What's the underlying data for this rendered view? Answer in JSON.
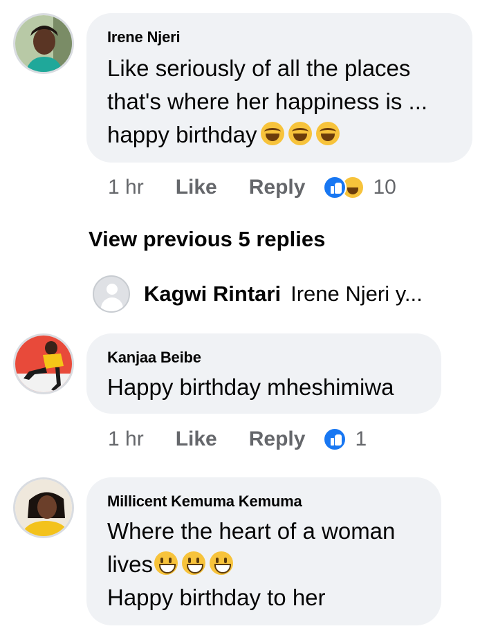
{
  "comments": [
    {
      "author": "Irene Njeri",
      "text_lines": [
        "Like seriously of all the places",
        "that's where her happiness is ...",
        "happy birthday"
      ],
      "emojis": [
        "laughing-emoji",
        "laughing-emoji",
        "laughing-emoji"
      ],
      "time": "1 hr",
      "like_label": "Like",
      "reply_label": "Reply",
      "reactions": [
        "like",
        "haha"
      ],
      "reaction_count": "10"
    },
    {
      "author": "Kanjaa Beibe",
      "text_lines": [
        "Happy birthday mheshimiwa"
      ],
      "time": "1 hr",
      "like_label": "Like",
      "reply_label": "Reply",
      "reactions": [
        "like"
      ],
      "reaction_count": "1"
    },
    {
      "author": "Millicent Kemuma Kemuma",
      "text_lines": [
        "Where the heart of a woman",
        "lives",
        "Happy birthday to her"
      ],
      "emojis": [
        "smiley-emoji",
        "smiley-emoji",
        "smiley-emoji"
      ]
    }
  ],
  "view_previous": "View previous 5 replies",
  "reply_preview": {
    "author": "Kagwi Rintari",
    "snippet": "Irene Njeri y..."
  },
  "colors": {
    "bubble": "#f0f2f5",
    "meta_text": "#65676b",
    "like_blue": "#1877f2",
    "emoji_yellow": "#f7c33b"
  }
}
